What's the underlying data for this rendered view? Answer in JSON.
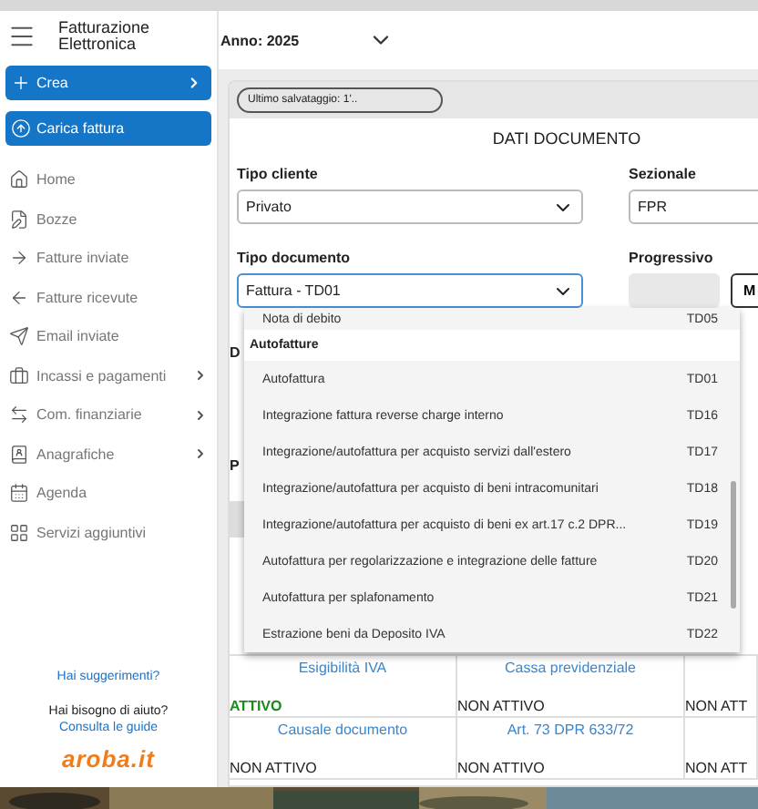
{
  "app": {
    "title": "Fatturazione Elettronica",
    "year": "Anno: 2025"
  },
  "sidebar": {
    "actions": [
      {
        "label": "Crea",
        "expandable": true
      },
      {
        "label": "Carica fattura",
        "expandable": false
      }
    ],
    "items": [
      {
        "label": "Home",
        "expandable": false
      },
      {
        "label": "Bozze",
        "expandable": false
      },
      {
        "label": "Fatture inviate",
        "expandable": false
      },
      {
        "label": "Fatture ricevute",
        "expandable": false
      },
      {
        "label": "Email inviate",
        "expandable": false
      },
      {
        "label": "Incassi e pagamenti",
        "expandable": true
      },
      {
        "label": "Com. finanziarie",
        "expandable": true
      },
      {
        "label": "Anagrafiche",
        "expandable": true
      },
      {
        "label": "Agenda",
        "expandable": false
      },
      {
        "label": "Servizi aggiuntivi",
        "expandable": false
      }
    ],
    "help": {
      "suggestions": "Hai suggerimenti?",
      "question": "Hai bisogno di aiuto?",
      "guides": "Consulta le guide",
      "logo": "aroba.it"
    }
  },
  "document": {
    "last_saved": "Ultimo salvataggio: 1'..",
    "section_title": "DATI DOCUMENTO",
    "client_type": {
      "label": "Tipo cliente",
      "value": "Privato"
    },
    "sezionale": {
      "label": "Sezionale",
      "value": "FPR"
    },
    "doc_type": {
      "label": "Tipo documento",
      "value": "Fattura - TD01"
    },
    "progressivo": {
      "label": "Progressivo",
      "button": "M"
    },
    "partial_labels": [
      "D",
      "P"
    ],
    "dropdown": [
      {
        "kind": "option",
        "label": "Nota di debito",
        "code": "TD05"
      },
      {
        "kind": "group",
        "label": "Autofatture"
      },
      {
        "kind": "option",
        "label": "Autofattura",
        "code": "TD01"
      },
      {
        "kind": "option",
        "label": "Integrazione fattura reverse charge interno",
        "code": "TD16"
      },
      {
        "kind": "option",
        "label": "Integrazione/autofattura per acquisto servizi dall'estero",
        "code": "TD17"
      },
      {
        "kind": "option",
        "label": "Integrazione/autofattura per acquisto di beni intracomunitari",
        "code": "TD18"
      },
      {
        "kind": "option",
        "label": "Integrazione/autofattura per acquisto di beni ex art.17 c.2 DPR...",
        "code": "TD19"
      },
      {
        "kind": "option",
        "label": "Autofattura per regolarizzazione e integrazione delle fatture",
        "code": "TD20"
      },
      {
        "kind": "option",
        "label": "Autofattura per splafonamento",
        "code": "TD21"
      },
      {
        "kind": "option",
        "label": "Estrazione beni da Deposito IVA",
        "code": "TD22"
      }
    ],
    "features": [
      [
        {
          "title": "Esigibilità IVA",
          "status": "ATTIVO",
          "active": true
        },
        {
          "title": "Cassa previdenziale",
          "status": "NON ATTIVO",
          "active": false
        },
        {
          "status": "NON ATT",
          "active": false
        }
      ],
      [
        {
          "title": "Causale documento",
          "status": "NON ATTIVO",
          "active": false
        },
        {
          "title": "Art. 73 DPR 633/72",
          "status": "NON ATTIVO",
          "active": false
        },
        {
          "status": "NON ATT",
          "active": false
        }
      ]
    ]
  }
}
